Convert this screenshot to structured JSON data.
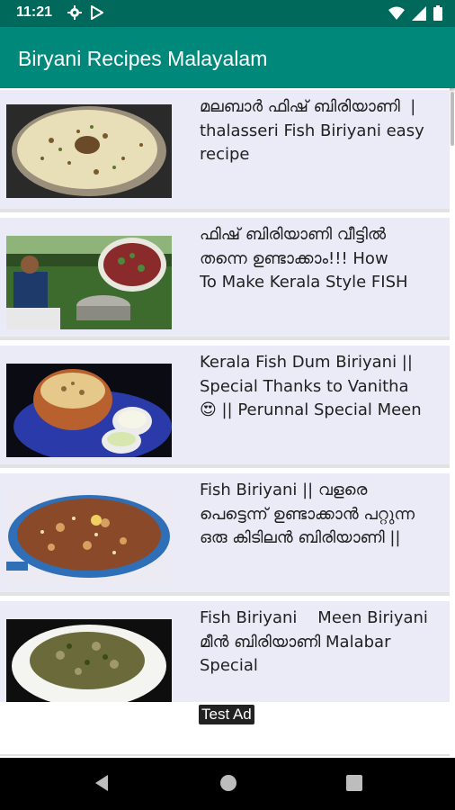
{
  "status_bar": {
    "time": "11:21",
    "icons_left": [
      "gear-icon",
      "play-store-icon"
    ],
    "icons_right": [
      "wifi-icon",
      "signal-icon",
      "battery-icon"
    ]
  },
  "app_bar": {
    "title": "Biryani Recipes Malayalam",
    "color": "#00897b",
    "status_color": "#00695c"
  },
  "videos": [
    {
      "title": "മലബാർ ഫിഷ് ബിരിയാണി  |\nthalasseri Fish Biriyani easy\nrecipe",
      "thumbnail": "fish-biriyani-bowl-thumbnail"
    },
    {
      "title": "ഫിഷ് ബിരിയാണി വീട്ടിൽ\nതന്നെ ഉണ്ടാക്കാം!!! How\nTo Make Kerala Style FISH",
      "thumbnail": "outdoor-cooking-thumbnail"
    },
    {
      "title": "Kerala Fish Dum Biriyani ||\nSpecial Thanks to Vanitha\n😍 || Perunnal Special Meen",
      "thumbnail": "clay-pot-biriyani-thumbnail"
    },
    {
      "title": "Fish Biriyani || വളരെ\nപെട്ടെന്ന് ഉണ്ടാക്കാൻ പറ്റുന്ന\nഒരു കിടിലൻ ബിരിയാണി ||",
      "thumbnail": "pan-fish-biriyani-thumbnail"
    },
    {
      "title": "Fish Biriyani    Meen Biriyani\nമീൻ ബിരിയാണി Malabar\nSpecial",
      "thumbnail": "plate-meen-biriyani-thumbnail"
    }
  ],
  "ad": {
    "label": "Test Ad"
  },
  "nav_bar": {
    "buttons": [
      "back-icon",
      "home-icon",
      "recents-icon"
    ]
  }
}
